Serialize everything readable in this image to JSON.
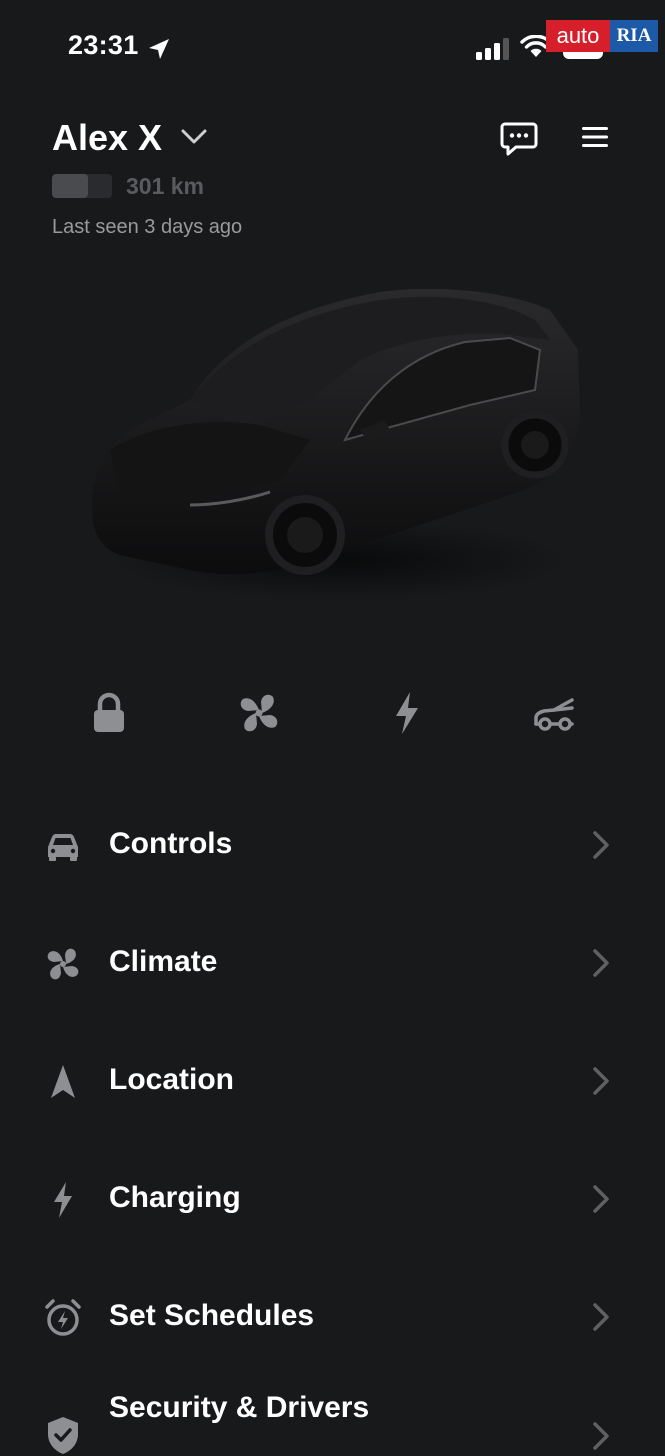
{
  "status_bar": {
    "time": "23:31",
    "battery_level": "69"
  },
  "watermark": {
    "auto": "auto",
    "ria": "RIA"
  },
  "header": {
    "car_name": "Alex X",
    "range": "301 km",
    "battery_fill": 0.6,
    "last_seen": "Last seen 3 days ago"
  },
  "quick_actions": [
    {
      "icon": "lock-icon"
    },
    {
      "icon": "fan-icon"
    },
    {
      "icon": "bolt-icon"
    },
    {
      "icon": "frunk-icon"
    }
  ],
  "menu": [
    {
      "label": "Controls",
      "icon": "car-icon"
    },
    {
      "label": "Climate",
      "icon": "fan-icon"
    },
    {
      "label": "Location",
      "icon": "navigation-icon"
    },
    {
      "label": "Charging",
      "icon": "bolt-icon"
    },
    {
      "label": "Set Schedules",
      "icon": "alarm-clock-icon"
    },
    {
      "label": "Security & Drivers",
      "icon": "shield-icon"
    }
  ],
  "colors": {
    "background": "#18191b",
    "icon_gray": "#8e8f92",
    "text_secondary": "#9a9a9c"
  }
}
